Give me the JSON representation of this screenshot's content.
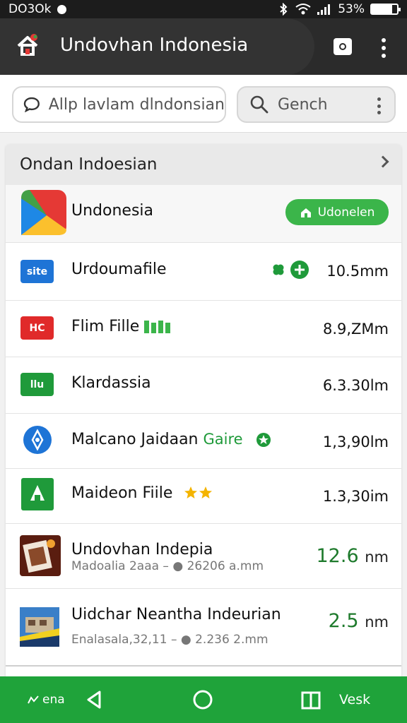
{
  "status_bar": {
    "time": "DO3Ok",
    "battery": "53%",
    "battery_level": 0.8
  },
  "app_bar": {
    "title": "Undovhan Indonesia",
    "icons": [
      "home-logo-icon",
      "camera-icon",
      "overflow-menu-icon"
    ]
  },
  "search": {
    "input_value": "Allp lavlam dlndonsian",
    "button_label": "Gench"
  },
  "section": {
    "title": "Ondan Indoesian"
  },
  "featured": {
    "title": "Undonesia",
    "button_label": "Udonelen"
  },
  "files": [
    {
      "icon_text": "site",
      "icon_color": "#1e74d6",
      "title": "Urdoumafile",
      "tag": "",
      "subtitle": "",
      "size": "10.5mm"
    },
    {
      "icon_text": "HC",
      "icon_color": "#e02a2a",
      "title": "Flim Fille",
      "tag": "",
      "subtitle": "",
      "size": "8.9,ZMm"
    },
    {
      "icon_text": "llu",
      "icon_color": "#1f9a3a",
      "title": "Klardassia",
      "tag": "",
      "subtitle": "",
      "size": "6.3.30lm"
    },
    {
      "icon_text": "",
      "icon_color": "#1e74d6",
      "title": "Malcano Jaidaan",
      "tag": "Gaire",
      "subtitle": "",
      "size": "1,3,90lm"
    },
    {
      "icon_text": "",
      "icon_color": "#1f9a3a",
      "title": "Maideon Fiile",
      "tag": "",
      "subtitle": "",
      "size": "1.3,30im"
    },
    {
      "icon_text": "",
      "icon_color": "#7a2a1a",
      "title": "Undovhan Indepia",
      "tag": "",
      "subtitle": "Madoalia 2aaa – ● 26206 a.mm",
      "size": "12.6",
      "size_unit": "nm"
    },
    {
      "icon_text": "",
      "icon_color": "#2a6fb0",
      "title": "Uidchar Neantha Indeurian",
      "tag": "",
      "subtitle": "Enalasala,32,11 – ● 2.236 2.mm",
      "size": "2.5",
      "size_unit": "nm"
    }
  ],
  "bottom_nav": {
    "left_label": "ena",
    "right_label": "Vesk"
  },
  "colors": {
    "accent_green": "#1fa33a",
    "app_bar": "#2b2b2b"
  }
}
